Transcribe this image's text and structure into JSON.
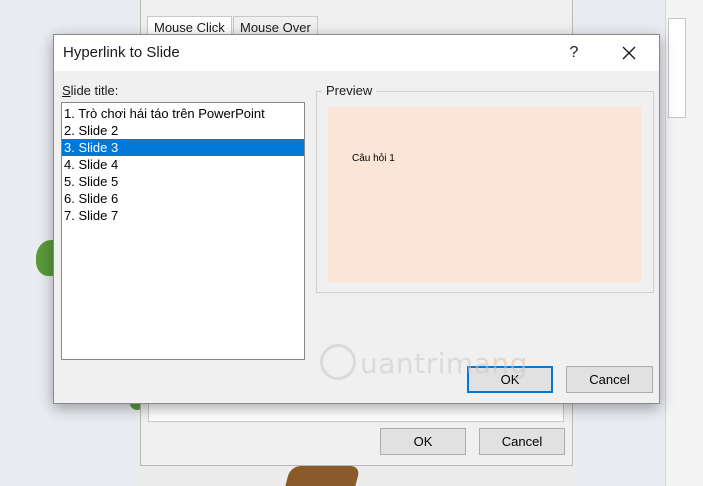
{
  "background": {
    "tabs": [
      {
        "label": "Mouse Click"
      },
      {
        "label": "Mouse Over"
      }
    ],
    "ok_label": "OK",
    "cancel_label": "Cancel"
  },
  "dialog": {
    "title": "Hyperlink to Slide",
    "help_label": "?",
    "slide_title_label_accel": "S",
    "slide_title_label_rest": "lide title:",
    "slides": [
      {
        "label": "1. Trò chơi hái táo trên PowerPoint"
      },
      {
        "label": "2. Slide 2"
      },
      {
        "label": "3. Slide 3"
      },
      {
        "label": "4. Slide 4"
      },
      {
        "label": "5. Slide 5"
      },
      {
        "label": "6. Slide 6"
      },
      {
        "label": "7. Slide 7"
      }
    ],
    "selected_index": 2,
    "preview_label": "Preview",
    "preview_text": "Câu hỏi 1",
    "preview_bg": "#fbe5d6",
    "ok_label": "OK",
    "cancel_label": "Cancel"
  },
  "watermark": {
    "text": "uantrimang"
  },
  "colors": {
    "selection": "#0078d7",
    "dialog_bg": "#f0f0f0"
  }
}
